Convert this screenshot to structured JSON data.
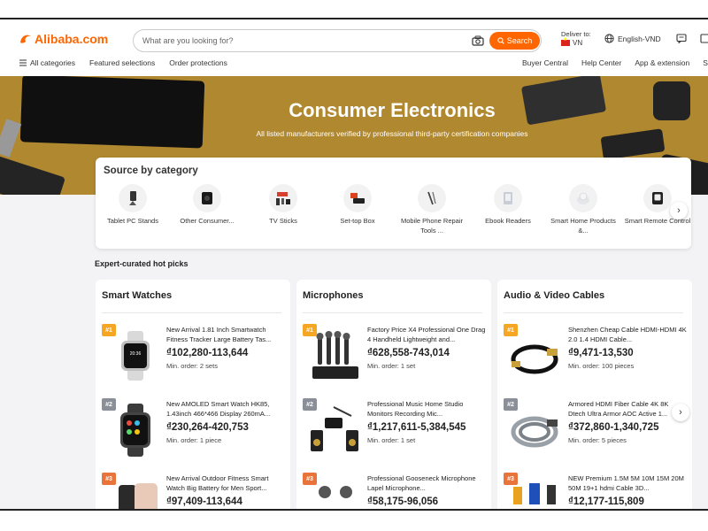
{
  "header": {
    "logo_text": "Alibaba.com",
    "search_placeholder": "What are you looking for?",
    "search_button": "Search",
    "deliver_label": "Deliver to:",
    "deliver_country": "VN",
    "language": "English-VND"
  },
  "nav": {
    "left": [
      "All categories",
      "Featured selections",
      "Order protections"
    ],
    "right": [
      "Buyer Central",
      "Help Center",
      "App & extension",
      "Se"
    ]
  },
  "hero": {
    "title": "Consumer Electronics",
    "subtitle": "All listed manufacturers verified by professional third-party certification companies"
  },
  "categories": {
    "title": "Source by category",
    "items": [
      {
        "label": "Tablet PC Stands",
        "icon": "tablet-stand-icon"
      },
      {
        "label": "Other Consumer...",
        "icon": "speaker-icon"
      },
      {
        "label": "TV Sticks",
        "icon": "tv-stick-icon"
      },
      {
        "label": "Set-top Box",
        "icon": "set-top-box-icon"
      },
      {
        "label": "Mobile Phone Repair Tools ...",
        "icon": "screwdriver-icon"
      },
      {
        "label": "Ebook Readers",
        "icon": "ebook-icon"
      },
      {
        "label": "Smart Home Products &...",
        "icon": "smart-home-icon"
      },
      {
        "label": "Smart Remote Control",
        "icon": "remote-control-icon"
      }
    ]
  },
  "hot_picks": {
    "title": "Expert-curated hot picks",
    "cards": [
      {
        "title": "Smart Watches",
        "products": [
          {
            "rank": "#1",
            "name": "New Arrival 1.81 Inch Smartwatch Fitness Tracker Large Battery Tas...",
            "price": "₫102,280-113,644",
            "moq": "Min. order: 2 sets"
          },
          {
            "rank": "#2",
            "name": "New AMOLED Smart Watch HK85, 1.43inch 466*466 Display 260mA...",
            "price": "₫230,264-420,753",
            "moq": "Min. order: 1 piece"
          },
          {
            "rank": "#3",
            "name": "New Arrival Outdoor Fitness Smart Watch Big Battery for Men Sport...",
            "price": "₫97,409-113,644",
            "moq": ""
          }
        ]
      },
      {
        "title": "Microphones",
        "products": [
          {
            "rank": "#1",
            "name": "Factory Price X4 Professional One Drag 4 Handheld Lightweight and...",
            "price": "₫628,558-743,014",
            "moq": "Min. order: 1 set"
          },
          {
            "rank": "#2",
            "name": "Professional Music Home Studio Monitors Recording Mic...",
            "price": "₫1,217,611-5,384,545",
            "moq": "Min. order: 1 set"
          },
          {
            "rank": "#3",
            "name": "Professional Gooseneck Microphone Lapel Microphone...",
            "price": "₫58,175-96,056",
            "moq": ""
          }
        ]
      },
      {
        "title": "Audio & Video Cables",
        "products": [
          {
            "rank": "#1",
            "name": "Shenzhen Cheap Cable HDMI-HDMI 4K 2.0 1.4 HDMI Cable...",
            "price": "₫9,471-13,530",
            "moq": "Min. order: 100 pieces"
          },
          {
            "rank": "#2",
            "name": "Armored HDMI Fiber Cable 4K 8K Dtech Ultra Armor AOC Active 1...",
            "price": "₫372,860-1,340,725",
            "moq": "Min. order: 5 pieces"
          },
          {
            "rank": "#3",
            "name": "NEW Premium 1.5M 5M 10M 15M 20M 50M 19+1 hdmi Cable 3D...",
            "price": "₫12,177-115,809",
            "moq": ""
          }
        ]
      }
    ]
  },
  "colors": {
    "brand": "#ff6600",
    "rank1": "#f5a623",
    "rank2": "#8a8f98",
    "rank3": "#e8743b"
  }
}
